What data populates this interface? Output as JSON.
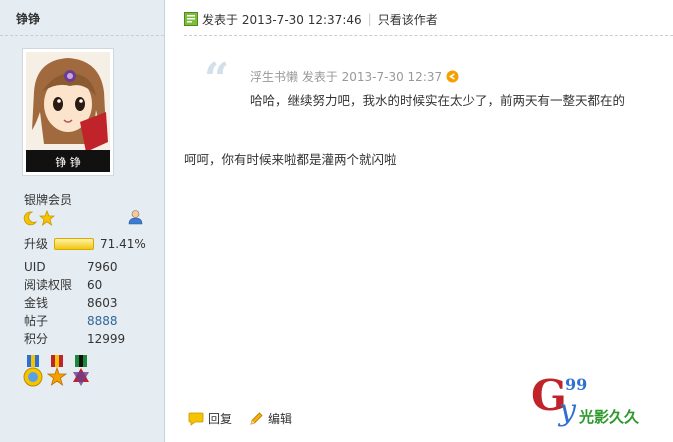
{
  "author": {
    "username": "铮铮",
    "group": "银牌会员",
    "upgrade_label": "升级",
    "upgrade_percent": "71.41%",
    "upgrade_progress": 0.7141,
    "stats": [
      {
        "label": "UID",
        "value": "7960"
      },
      {
        "label": "阅读权限",
        "value": "60"
      },
      {
        "label": "金钱",
        "value": "8603"
      },
      {
        "label": "帖子",
        "value": "8888"
      },
      {
        "label": "积分",
        "value": "12999"
      }
    ],
    "avatar_caption": "铮 铮"
  },
  "post": {
    "posted_at": "发表于 2013-7-30 12:37:46",
    "author_only": "只看该作者",
    "quote": {
      "meta": "浮生书懒 发表于 2013-7-30 12:37",
      "text": "哈哈，继续努力吧，我水的时候实在太少了，前两天有一整天都在的"
    },
    "body": "呵呵，你有时候来啦都是灌两个就闪啦",
    "actions": {
      "reply": "回复",
      "edit": "编辑"
    }
  },
  "watermark": {
    "big": "G",
    "sup": "99",
    "small": "y",
    "cn": "光影久久"
  },
  "colors": {
    "sidebar_bg": "#e5edf2",
    "link": "#336699",
    "upgrade": "#f2c60f"
  },
  "icons": [
    "doc-icon",
    "back-arrow-icon",
    "moon-icon",
    "star-icon",
    "user-icon",
    "medal-icon",
    "reply-icon",
    "edit-icon"
  ]
}
